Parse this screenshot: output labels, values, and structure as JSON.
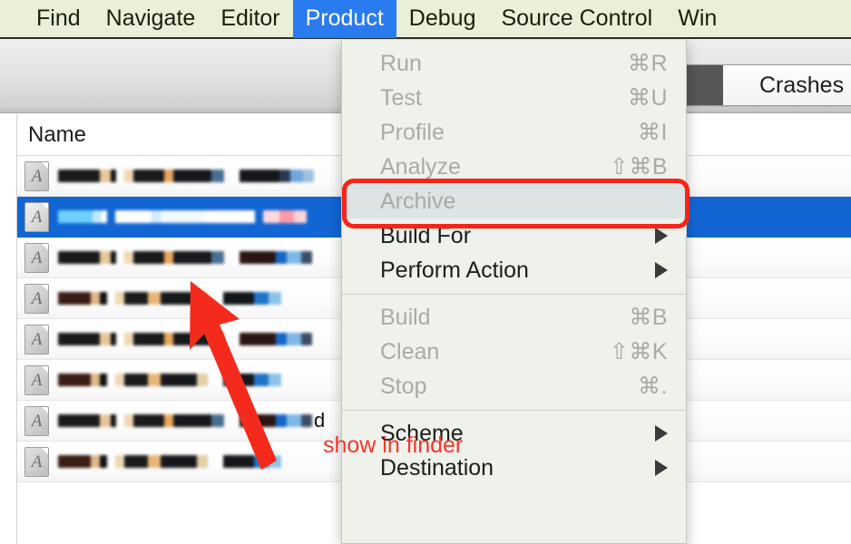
{
  "menubar": {
    "items": [
      {
        "label": "Find",
        "active": false
      },
      {
        "label": "Navigate",
        "active": false
      },
      {
        "label": "Editor",
        "active": false
      },
      {
        "label": "Product",
        "active": true
      },
      {
        "label": "Debug",
        "active": false
      },
      {
        "label": "Source Control",
        "active": false
      },
      {
        "label": "Win",
        "active": false
      }
    ],
    "active_highlight_color": "#2a7af0",
    "background_color": "#e9efd9"
  },
  "toolbar": {
    "segment_label": "Crashes",
    "segment_button_icon": "filled-square-icon"
  },
  "file_table": {
    "header": "Name",
    "selected_row_index": 1,
    "selection_color": "#1266d4",
    "rows": [
      {
        "icon": "app-document-icon",
        "name_redacted": true,
        "trailing_text": ""
      },
      {
        "icon": "app-document-icon",
        "name_redacted": true,
        "trailing_text": ""
      },
      {
        "icon": "app-document-icon",
        "name_redacted": true,
        "trailing_text": ""
      },
      {
        "icon": "app-document-icon",
        "name_redacted": true,
        "trailing_text": ""
      },
      {
        "icon": "app-document-icon",
        "name_redacted": true,
        "trailing_text": ""
      },
      {
        "icon": "app-document-icon",
        "name_redacted": true,
        "trailing_text": ""
      },
      {
        "icon": "app-document-icon",
        "name_redacted": true,
        "trailing_text": "d"
      },
      {
        "icon": "app-document-icon",
        "name_redacted": true,
        "trailing_text": ""
      }
    ]
  },
  "product_menu": {
    "title": "Product",
    "groups": [
      {
        "items": [
          {
            "label": "Run",
            "shortcut": "⌘R",
            "enabled": false,
            "submenu": false,
            "highlighted": false
          },
          {
            "label": "Test",
            "shortcut": "⌘U",
            "enabled": false,
            "submenu": false,
            "highlighted": false
          },
          {
            "label": "Profile",
            "shortcut": "⌘I",
            "enabled": false,
            "submenu": false,
            "highlighted": false
          },
          {
            "label": "Analyze",
            "shortcut": "⇧⌘B",
            "enabled": false,
            "submenu": false,
            "highlighted": false
          },
          {
            "label": "Archive",
            "shortcut": "",
            "enabled": false,
            "submenu": false,
            "highlighted": true
          },
          {
            "label": "Build For",
            "shortcut": "",
            "enabled": true,
            "submenu": true,
            "highlighted": false
          },
          {
            "label": "Perform Action",
            "shortcut": "",
            "enabled": true,
            "submenu": true,
            "highlighted": false
          }
        ]
      },
      {
        "items": [
          {
            "label": "Build",
            "shortcut": "⌘B",
            "enabled": false,
            "submenu": false,
            "highlighted": false
          },
          {
            "label": "Clean",
            "shortcut": "⇧⌘K",
            "enabled": false,
            "submenu": false,
            "highlighted": false
          },
          {
            "label": "Stop",
            "shortcut": "⌘.",
            "enabled": false,
            "submenu": false,
            "highlighted": false
          }
        ]
      },
      {
        "items": [
          {
            "label": "Scheme",
            "shortcut": "",
            "enabled": true,
            "submenu": true,
            "highlighted": false
          },
          {
            "label": "Destination",
            "shortcut": "",
            "enabled": true,
            "submenu": true,
            "highlighted": false
          }
        ]
      }
    ]
  },
  "annotations": {
    "color": "#fa2317",
    "note_text": "show in finder",
    "highlight_target": "Archive",
    "arrow_points_to": "file-table-row-3"
  }
}
